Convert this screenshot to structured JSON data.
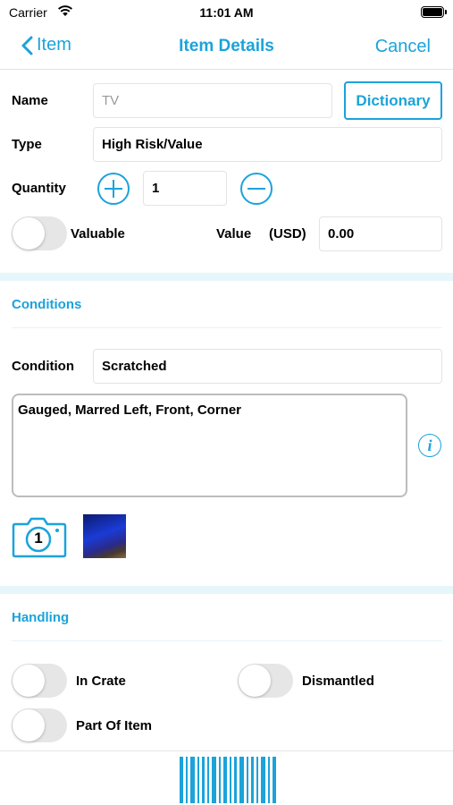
{
  "status_bar": {
    "carrier": "Carrier",
    "time": "11:01 AM"
  },
  "nav": {
    "back_label": "Item",
    "title": "Item Details",
    "cancel_label": "Cancel"
  },
  "form": {
    "name_label": "Name",
    "name_placeholder": "TV",
    "dictionary_label": "Dictionary",
    "type_label": "Type",
    "type_value": "High Risk/Value",
    "quantity_label": "Quantity",
    "quantity_value": "1",
    "valuable_label": "Valuable",
    "valuable_on": false,
    "value_label": "Value",
    "currency_label": "(USD)",
    "value_value": "0.00"
  },
  "conditions": {
    "section_title": "Conditions",
    "condition_label": "Condition",
    "condition_value": "Scratched",
    "notes": "Gauged, Marred Left, Front, Corner",
    "photo_count": "1"
  },
  "handling": {
    "section_title": "Handling",
    "options": [
      {
        "label": "In Crate",
        "on": false
      },
      {
        "label": "Dismantled",
        "on": false
      },
      {
        "label": "Part Of Item",
        "on": false
      }
    ]
  },
  "colors": {
    "accent": "#1ba3da",
    "section_band": "#e6f6fb",
    "toggle_off": "#e6e6e6"
  },
  "icons": {
    "back": "chevron-left-icon",
    "info": "info-icon",
    "camera": "camera-icon",
    "barcode": "barcode-icon"
  }
}
